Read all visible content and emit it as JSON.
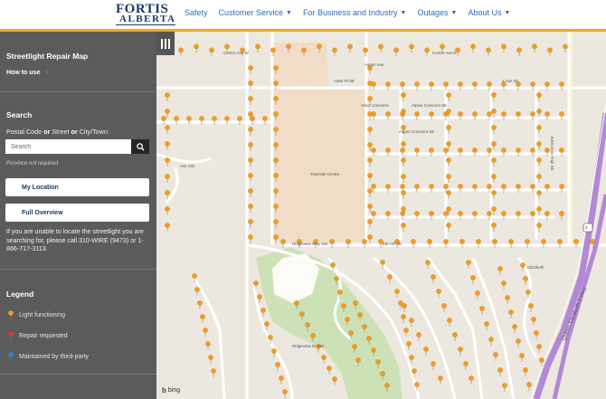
{
  "header": {
    "logo_top": "FORTIS",
    "logo_bottom": "ALBERTA",
    "nav": [
      {
        "label": "Safety",
        "has_dropdown": false
      },
      {
        "label": "Customer Service",
        "has_dropdown": true
      },
      {
        "label": "For Business and Industry",
        "has_dropdown": true
      },
      {
        "label": "Outages",
        "has_dropdown": true
      },
      {
        "label": "About Us",
        "has_dropdown": true
      }
    ],
    "accent_color": "#f5a623",
    "brand_color": "#1b3a6b"
  },
  "sidebar": {
    "title": "Streetlight Repair Map",
    "how_to": "How to use",
    "search": {
      "title": "Search",
      "hint_parts": [
        "Postal Code ",
        "or",
        " Street ",
        "or",
        " City/Town:"
      ],
      "placeholder": "Search",
      "note": "Province not required"
    },
    "buttons": {
      "my_location": "My Location",
      "full_overview": "Full Overview"
    },
    "help_text": "If you are unable to locate the streetlight you are searching for, please call 310-WIRE (9473) or 1-866-717-3113.",
    "legend": {
      "title": "Legend",
      "items": [
        {
          "label": "Light functioning",
          "color": "#f39c1f"
        },
        {
          "label": "Repair requested",
          "color": "#d9362b"
        },
        {
          "label": "Maintained by third-party",
          "color": "#2a7fd4"
        }
      ]
    }
  },
  "map": {
    "attribution": "bing",
    "road_labels": [
      "Centre Ave W",
      "Centre Ave E",
      "Aspen Ave",
      "Aster Pl SE",
      "1 Ave SE",
      "Arbor Crescent",
      "Alpine Crescent SE",
      "Aspen Crescent SE",
      "Edmonton Trail SE",
      "Townsite Centre",
      "Ridgeview Way SW",
      "Elk Hill SE",
      "Ridgeview Dr SW",
      "Queen Elizabeth II Hwy",
      "Elizabeth",
      "Ave SW"
    ],
    "highway_shield": "2"
  }
}
